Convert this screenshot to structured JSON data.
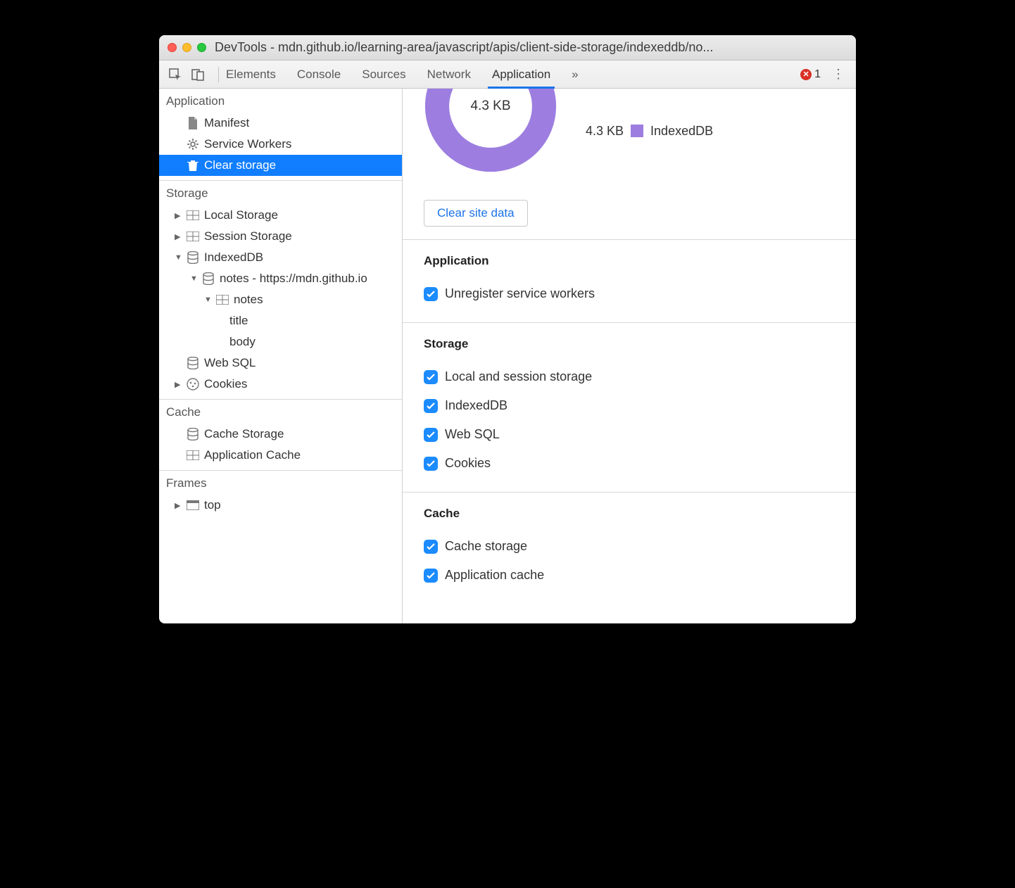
{
  "window": {
    "title": "DevTools - mdn.github.io/learning-area/javascript/apis/client-side-storage/indexeddb/no..."
  },
  "tabs": {
    "items": [
      "Elements",
      "Console",
      "Sources",
      "Network",
      "Application"
    ],
    "active": "Application",
    "overflow": "»",
    "error_count": "1"
  },
  "sidebar": {
    "sections": {
      "application": {
        "title": "Application",
        "items": {
          "manifest": "Manifest",
          "service_workers": "Service Workers",
          "clear_storage": "Clear storage"
        }
      },
      "storage": {
        "title": "Storage",
        "items": {
          "local_storage": "Local Storage",
          "session_storage": "Session Storage",
          "indexeddb": "IndexedDB",
          "db_notes": "notes - https://mdn.github.io",
          "store_notes": "notes",
          "field_title": "title",
          "field_body": "body",
          "web_sql": "Web SQL",
          "cookies": "Cookies"
        }
      },
      "cache": {
        "title": "Cache",
        "items": {
          "cache_storage": "Cache Storage",
          "application_cache": "Application Cache"
        }
      },
      "frames": {
        "title": "Frames",
        "items": {
          "top": "top"
        }
      }
    }
  },
  "main": {
    "usage_total": "4.3 KB",
    "legend_value": "4.3 KB",
    "legend_label": "IndexedDB",
    "clear_button": "Clear site data",
    "sections": {
      "application": {
        "title": "Application",
        "checks": {
          "unregister_sw": "Unregister service workers"
        }
      },
      "storage": {
        "title": "Storage",
        "checks": {
          "local_session": "Local and session storage",
          "indexeddb": "IndexedDB",
          "web_sql": "Web SQL",
          "cookies": "Cookies"
        }
      },
      "cache": {
        "title": "Cache",
        "checks": {
          "cache_storage": "Cache storage",
          "application_cache": "Application cache"
        }
      }
    }
  },
  "colors": {
    "accent": "#1b73e8",
    "donut": "#9d7ee0",
    "selection": "#117eff"
  }
}
